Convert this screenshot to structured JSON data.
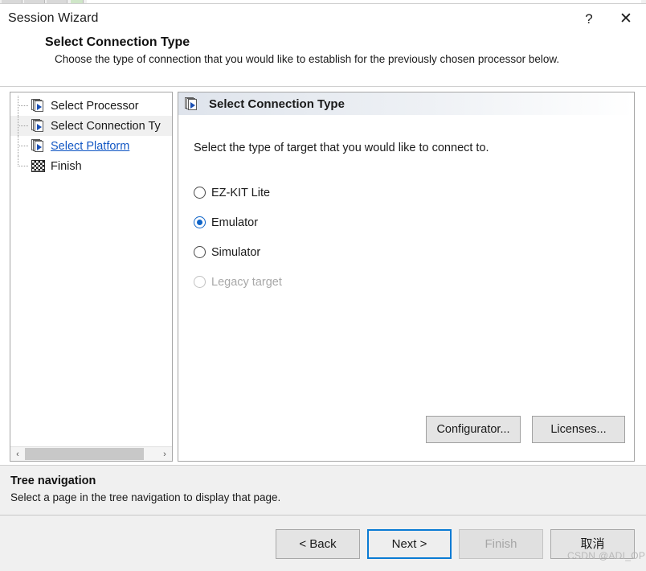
{
  "window": {
    "title": "Session Wizard",
    "help_glyph": "?",
    "close_glyph": "✕"
  },
  "header": {
    "heading": "Select Connection Type",
    "subheading": "Choose the type of connection that you would like to establish for the previously chosen processor below."
  },
  "tree": {
    "items": [
      {
        "label": "Select Processor",
        "icon": "page-arrow-icon",
        "state": "normal"
      },
      {
        "label": "Select Connection Ty",
        "icon": "page-arrow-icon",
        "state": "selected"
      },
      {
        "label": "Select Platform",
        "icon": "page-arrow-icon",
        "state": "link"
      },
      {
        "label": "Finish",
        "icon": "checkered-flag-icon",
        "state": "normal"
      }
    ],
    "scroll": {
      "left_arrow": "‹",
      "right_arrow": "›"
    }
  },
  "content": {
    "title": "Select Connection Type",
    "icon": "page-arrow-icon",
    "description": "Select the type of target that you would like to connect to.",
    "options": [
      {
        "label": "EZ-KIT Lite",
        "checked": false,
        "disabled": false
      },
      {
        "label": "Emulator",
        "checked": true,
        "disabled": false
      },
      {
        "label": "Simulator",
        "checked": false,
        "disabled": false
      },
      {
        "label": "Legacy target",
        "checked": false,
        "disabled": true
      }
    ],
    "buttons": {
      "configurator": "Configurator...",
      "licenses": "Licenses..."
    }
  },
  "infobar": {
    "title": "Tree navigation",
    "description": "Select a page in the tree navigation to display that page."
  },
  "footer": {
    "back": "< Back",
    "next": "Next >",
    "finish": "Finish",
    "cancel": "取消"
  },
  "watermark": "CSDN @ADI_OP",
  "colors": {
    "accent": "#0f64c8",
    "focus_border": "#0a7bd4",
    "link": "#1257c4",
    "disabled_text": "#a8a8a8",
    "panel_bg": "#f0f0f0"
  }
}
